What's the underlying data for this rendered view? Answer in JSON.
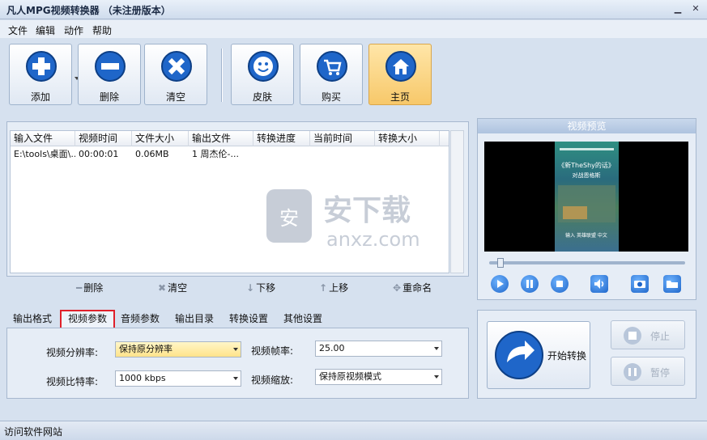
{
  "window": {
    "title": "凡人MPG视频转换器 （未注册版本）"
  },
  "menu": [
    "文件",
    "编辑",
    "动作",
    "帮助"
  ],
  "toolbar": {
    "add": "添加",
    "delete": "删除",
    "clear": "清空",
    "skin": "皮肤",
    "buy": "购买",
    "home": "主页"
  },
  "file_table": {
    "columns": [
      "输入文件",
      "视频时间",
      "文件大小",
      "输出文件",
      "转换进度",
      "当前时间",
      "转换大小"
    ],
    "rows": [
      [
        "E:\\tools\\桌面\\...",
        "00:00:01",
        "0.06MB",
        "1 周杰伦-...",
        "",
        "",
        ""
      ]
    ]
  },
  "watermark": {
    "text_cn": "安下载",
    "text_en": "anxz.com",
    "badge": "安"
  },
  "actions": {
    "delete": "删除",
    "clear": "清空",
    "down": "下移",
    "up": "上移",
    "rename": "重命名"
  },
  "tabs": [
    "输出格式",
    "视频参数",
    "音频参数",
    "输出目录",
    "转换设置",
    "其他设置"
  ],
  "params": {
    "resolution_label": "视频分辨率:",
    "resolution_value": "保持原分辨率",
    "bitrate_label": "视频比特率:",
    "bitrate_value": "1000 kbps",
    "framerate_label": "视频帧率:",
    "framerate_value": "25.00",
    "scale_label": "视频缩放:",
    "scale_value": "保持原视频模式"
  },
  "preview": {
    "title": "视频预览",
    "caption1": "《新TheShy的话》",
    "caption2": "对战恩格斯",
    "caption3": "输入 英雄联盟 中文"
  },
  "convert": {
    "start": "开始转换",
    "stop": "停止",
    "pause": "暂停"
  },
  "status": {
    "text": "访问软件网站"
  },
  "colors": {
    "accent": "#1f66c9",
    "highlight": "#e0202a",
    "active_button": "#f7c86a"
  }
}
